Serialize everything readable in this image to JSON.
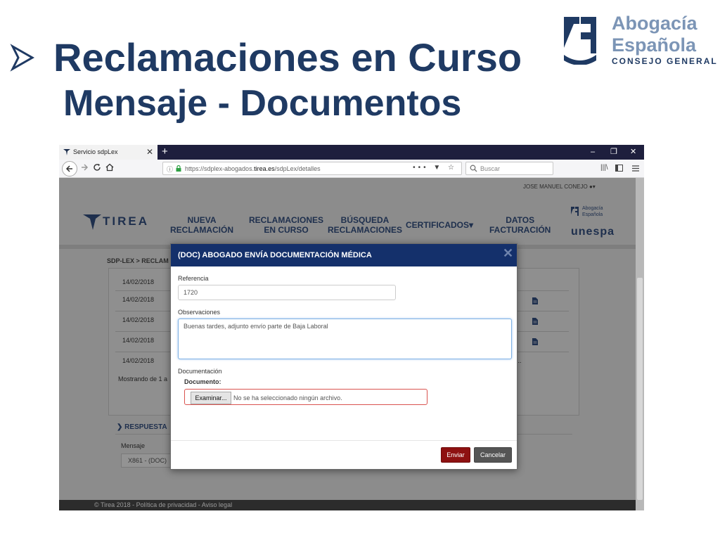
{
  "slide": {
    "title": "Reclamaciones en Curso",
    "subtitle": "Mensaje - Documentos"
  },
  "logo_abogacia": {
    "line1": "Abogacía",
    "line2": "Española",
    "line3": "CONSEJO GENERAL"
  },
  "browser": {
    "tab_title": "Servicio sdpLex",
    "tab_close": "✕",
    "new_tab": "+",
    "window_controls": [
      "–",
      "❐",
      "✕"
    ],
    "url_prefix": "https://sdplex-abogados.",
    "url_domain": "tirea.es",
    "url_suffix": "/sdpLex/detalles",
    "url_actions": "••• ▼ ☆",
    "search_placeholder": "Buscar",
    "toolbar_icons": [
      "library-icon",
      "sidebar-icon",
      "menu-icon"
    ]
  },
  "site": {
    "user": "JOSE MANUEL CONEJO",
    "logo_text": "TIREA",
    "menu": [
      {
        "line1": "NUEVA",
        "line2": "RECLAMACIÓN"
      },
      {
        "line1": "RECLAMACIONES",
        "line2": "EN CURSO"
      },
      {
        "line1": "BÚSQUEDA",
        "line2": "RECLAMACIONES"
      },
      {
        "line1": "CERTIFICADOS▾",
        "line2": ""
      },
      {
        "line1": "DATOS",
        "line2": "FACTURACIÓN"
      }
    ],
    "unespa": {
      "line1": "Abogacía",
      "line2": "Española",
      "name": "unespa"
    },
    "breadcrumb": "SDP-LEX > RECLAM",
    "dates": [
      "14/02/2018",
      "14/02/2018",
      "14/02/2018",
      "14/02/2018",
      "14/02/2018"
    ],
    "showing": "Mostrando de 1 a",
    "ellipsis": "...",
    "respuesta": "RESPUESTA",
    "mensaje_label": "Mensaje",
    "mensaje_value": "X861 - (DOC)",
    "footer": "© Tirea 2018 - Política de privacidad - Aviso legal"
  },
  "modal": {
    "title": "(DOC) ABOGADO ENVÍA DOCUMENTACIÓN MÉDICA",
    "close": "✕",
    "referencia_label": "Referencia",
    "referencia_value": "1720",
    "observaciones_label": "Observaciones",
    "observaciones_value": "Buenas tardes, adjunto envío parte de Baja Laboral",
    "documentacion_label": "Documentación",
    "documento_label": "Documento:",
    "file_button": "Examinar...",
    "file_status": "No se ha seleccionado ningún archivo.",
    "send_button": "Enviar",
    "cancel_button": "Cancelar"
  },
  "colors": {
    "title": "#1f3a63",
    "modal_header": "#14306b",
    "send": "#8e1111",
    "cancel": "#555555",
    "error_border": "#d9534f"
  }
}
